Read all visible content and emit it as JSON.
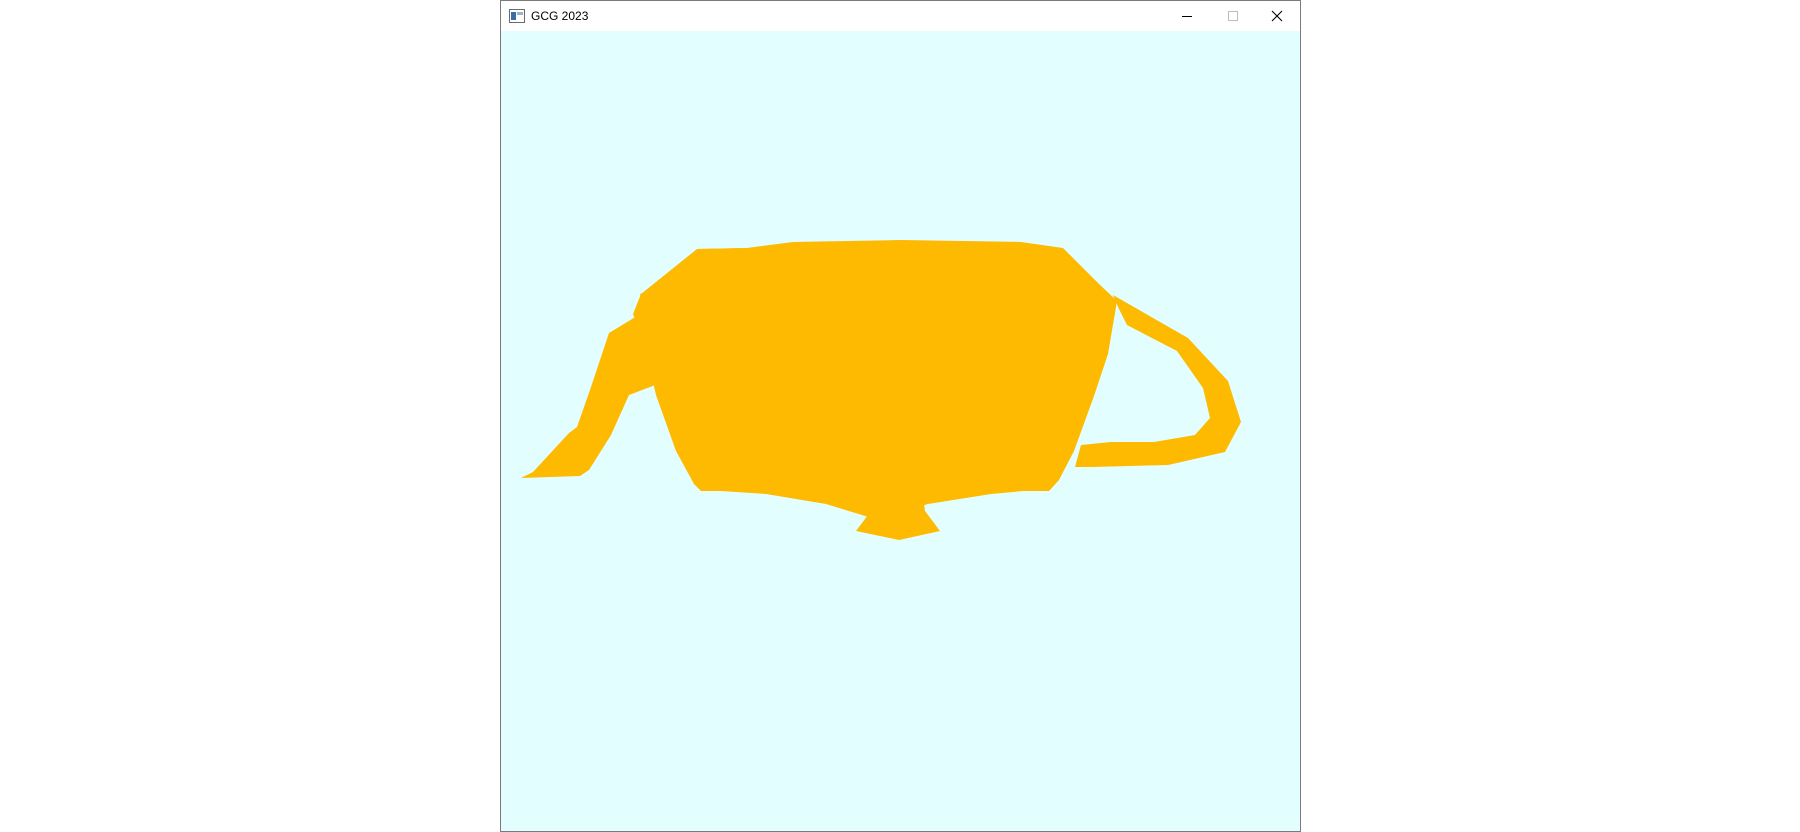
{
  "window": {
    "title": "GCG 2023",
    "controls": {
      "minimize_icon": "minimize-icon",
      "maximize_icon": "maximize-icon",
      "close_icon": "close-icon"
    }
  },
  "canvas": {
    "background_color": "#e3fefe",
    "shape": "teapot-silhouette",
    "fill_color": "#fdba00"
  }
}
